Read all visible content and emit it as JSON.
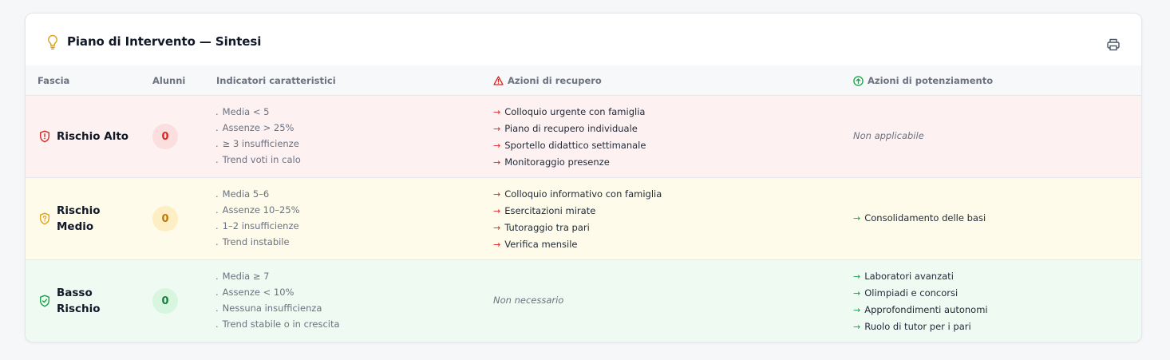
{
  "panel": {
    "title": "Piano di Intervento — Sintesi",
    "icon": "lightbulb-icon",
    "print_icon": "printer-icon"
  },
  "columns": {
    "fascia": "Fascia",
    "alunni": "Alunni",
    "indicatori": "Indicatori caratteristici",
    "recupero": "Azioni di recupero",
    "potenziamento": "Azioni di potenziamento"
  },
  "rows": [
    {
      "label": "Rischio Alto",
      "count": "0",
      "indicators": [
        "Media < 5",
        "Assenze > 25%",
        "≥ 3 insufficienze",
        "Trend voti in calo"
      ],
      "recupero": [
        "Colloquio urgente con famiglia",
        "Piano di recupero individuale",
        "Sportello didattico settimanale",
        "Monitoraggio presenze"
      ],
      "potenziamento": [],
      "potenziamento_note": "Non applicabile",
      "colors": {
        "bg": "#fef1f1",
        "accent": "#dc2626",
        "badge_bg": "#fbdede",
        "badge_fg": "#dc2626"
      }
    },
    {
      "label": "Rischio Medio",
      "count": "0",
      "indicators": [
        "Media 5–6",
        "Assenze 10–25%",
        "1–2 insufficienze",
        "Trend instabile"
      ],
      "recupero": [
        "Colloquio informativo con famiglia",
        "Esercitazioni mirate",
        "Tutoraggio tra pari",
        "Verifica mensile"
      ],
      "potenziamento": [
        "Consolidamento delle basi"
      ],
      "colors": {
        "bg": "#fefbea",
        "accent": "#e0a11b",
        "badge_bg": "#fdefc3",
        "badge_fg": "#c2760a"
      }
    },
    {
      "label": "Basso Rischio",
      "count": "0",
      "indicators": [
        "Media ≥ 7",
        "Assenze < 10%",
        "Nessuna insufficienza",
        "Trend stabile o in crescita"
      ],
      "recupero": [],
      "recupero_note": "Non necessario",
      "potenziamento": [
        "Laboratori avanzati",
        "Olimpiadi e concorsi",
        "Approfondimenti autonomi",
        "Ruolo di tutor per i pari"
      ],
      "colors": {
        "bg": "#effbf2",
        "accent": "#16a34a",
        "badge_bg": "#d7f5df",
        "badge_fg": "#15803d"
      }
    }
  ],
  "colors": {
    "recupero_arrow": "#dc2626",
    "potenziamento_arrow": "#16a34a"
  }
}
